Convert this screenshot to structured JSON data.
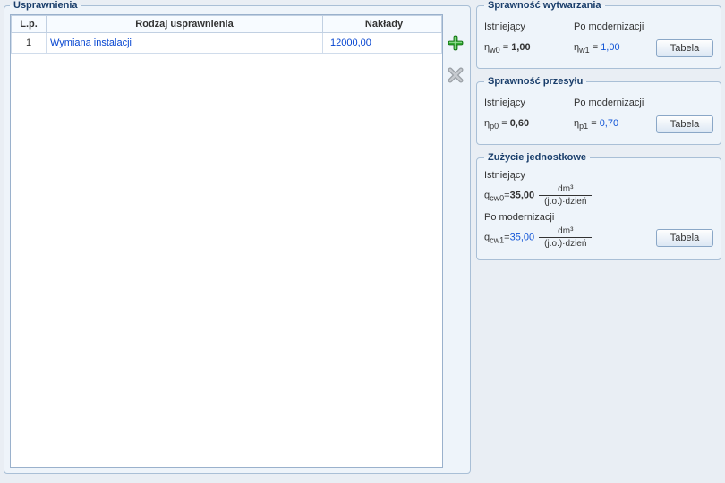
{
  "left": {
    "title": "Usprawnienia",
    "headers": {
      "lp": "L.p.",
      "rodzaj": "Rodzaj usprawnienia",
      "naklady": "Nakłady"
    },
    "rows": [
      {
        "lp": "1",
        "rodzaj": "Wymiana instalacji",
        "naklady": "12000,00"
      }
    ]
  },
  "right": {
    "wytwarzanie": {
      "title": "Sprawność wytwarzania",
      "existing_label": "Istniejący",
      "after_label": "Po modernizacji",
      "n0_sym": "η",
      "n0_sub": "w0",
      "n0_val": "1,00",
      "n1_sym": "η",
      "n1_sub": "w1",
      "n1_val": "1,00",
      "btn": "Tabela"
    },
    "przesyl": {
      "title": "Sprawność przesyłu",
      "existing_label": "Istniejący",
      "after_label": "Po modernizacji",
      "n0_sym": "η",
      "n0_sub": "p0",
      "n0_val": "0,60",
      "n1_sym": "η",
      "n1_sub": "p1",
      "n1_val": "0,70",
      "btn": "Tabela"
    },
    "zuzycie": {
      "title": "Zużycie jednostkowe",
      "existing_label": "Istniejący",
      "after_label": "Po modernizacji",
      "q0_sym": "q",
      "q0_sub": "cw0",
      "q0_val": "35,00",
      "q1_sym": "q",
      "q1_sub": "cw1",
      "q1_val": "35,00",
      "unit_num": "dm³",
      "unit_den": "(j.o.)·dzień",
      "btn": "Tabela"
    }
  }
}
